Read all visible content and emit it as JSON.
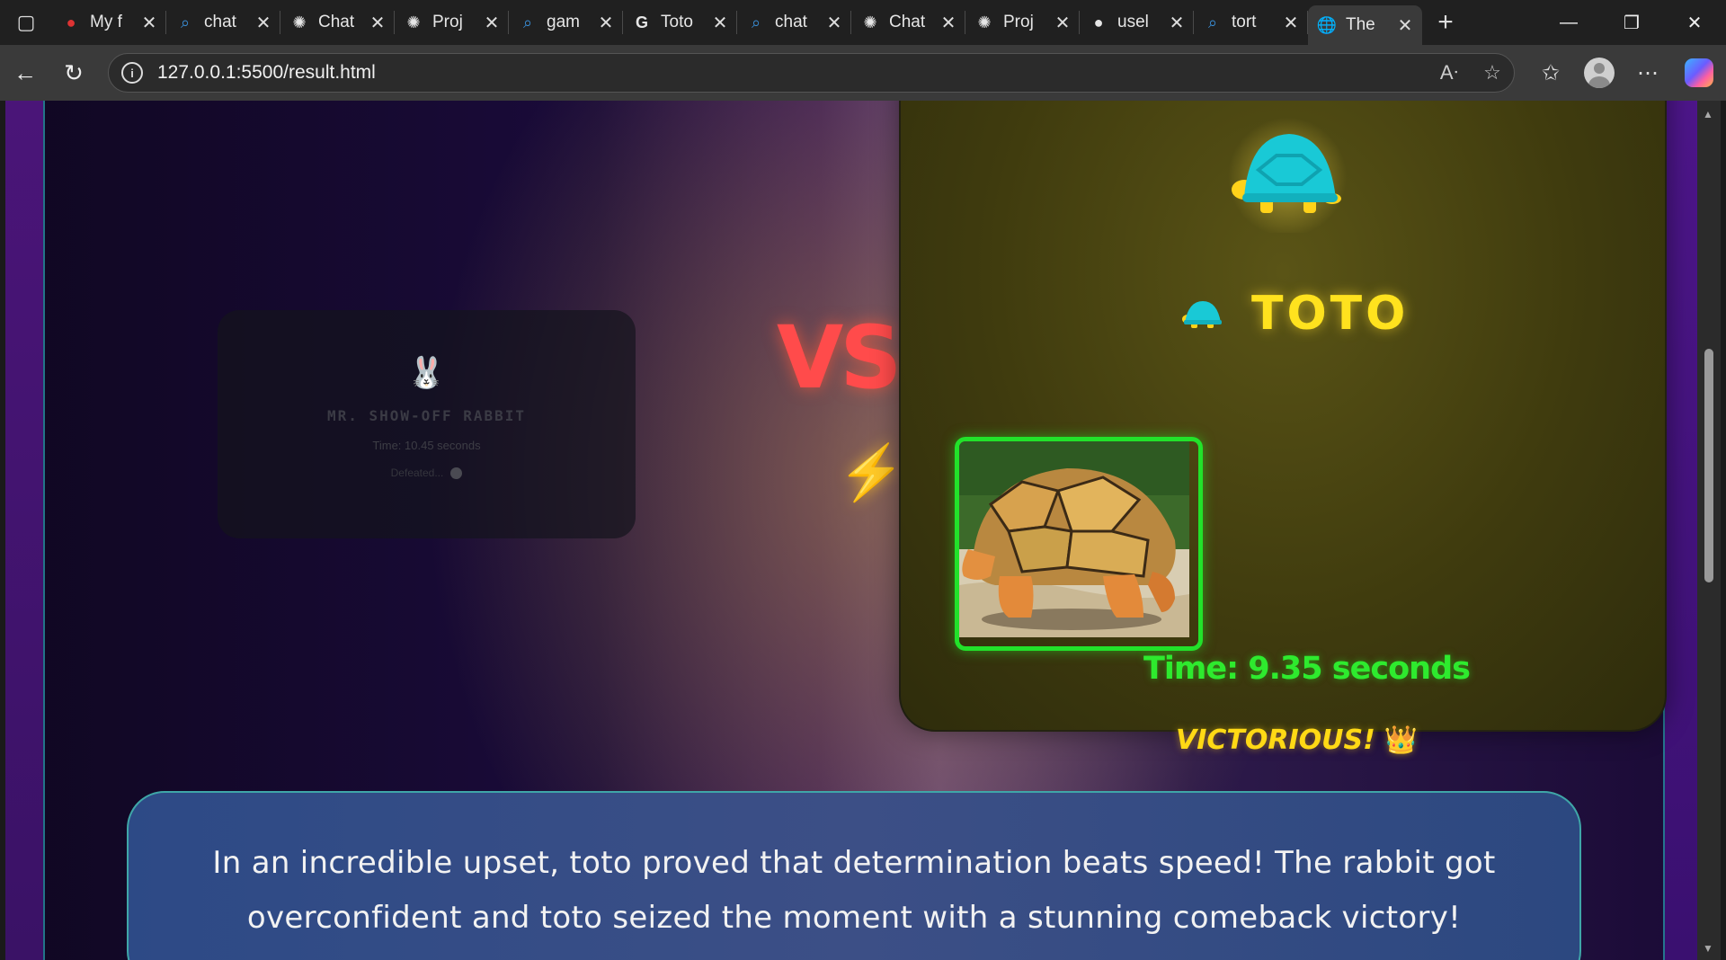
{
  "browser": {
    "tabs": [
      {
        "title": "My f",
        "icon": "chat-bubble-icon"
      },
      {
        "title": "chat",
        "icon": "search-icon"
      },
      {
        "title": "Chat",
        "icon": "openai-icon"
      },
      {
        "title": "Proj",
        "icon": "openai-icon"
      },
      {
        "title": "gam",
        "icon": "search-icon"
      },
      {
        "title": "Toto",
        "icon": "google-icon"
      },
      {
        "title": "chat",
        "icon": "search-icon"
      },
      {
        "title": "Chat",
        "icon": "openai-icon"
      },
      {
        "title": "Proj",
        "icon": "openai-icon"
      },
      {
        "title": "usel",
        "icon": "github-icon"
      },
      {
        "title": "tort",
        "icon": "search-icon"
      },
      {
        "title": "The",
        "icon": "globe-icon",
        "active": true
      }
    ],
    "address": "127.0.0.1:5500/result.html"
  },
  "page": {
    "loser": {
      "name": "MR. SHOW-OFF RABBIT",
      "time": "Time: 10.45 seconds",
      "status": "Defeated..."
    },
    "vs_label": "VS",
    "winner": {
      "name": "TOTO",
      "time": "Time: 9.35 seconds",
      "status": "VICTORIOUS!",
      "crown": "👑"
    },
    "story": "In an incredible upset, toto proved that determination beats speed! The rabbit got overconfident and toto seized the moment with a stunning comeback victory!"
  },
  "colors": {
    "winner_name": "#ffe21e",
    "winner_time": "#2eea2e",
    "vs": "#ff4b4b",
    "photo_border": "#22e22a"
  }
}
